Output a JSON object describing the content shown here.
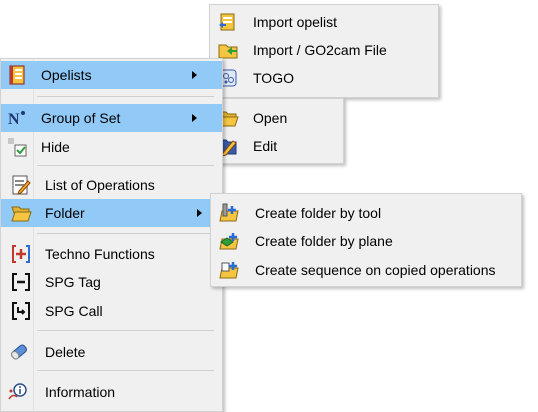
{
  "main_menu": {
    "items": [
      {
        "label": "Opelists"
      },
      {
        "label": "Group of Set"
      },
      {
        "label": "Hide"
      },
      {
        "label": "List of Operations"
      },
      {
        "label": "Folder"
      },
      {
        "label": "Techno Functions"
      },
      {
        "label": "SPG Tag"
      },
      {
        "label": "SPG Call"
      },
      {
        "label": "Delete"
      },
      {
        "label": "Information"
      }
    ]
  },
  "opelists_submenu": {
    "items": [
      {
        "label": "Import opelist"
      },
      {
        "label": "Import / GO2cam File"
      },
      {
        "label": "TOGO"
      }
    ]
  },
  "group_submenu": {
    "items": [
      {
        "label": "Open"
      },
      {
        "label": "Edit"
      }
    ]
  },
  "folder_submenu": {
    "items": [
      {
        "label": "Create folder by tool"
      },
      {
        "label": "Create folder by plane"
      },
      {
        "label": "Create sequence on copied operations"
      }
    ]
  },
  "colors": {
    "highlight": "#91c9f7",
    "menu_bg": "#f0f0f0",
    "folder_yellow": "#f5c542",
    "accent_blue": "#2b6cd4"
  },
  "icons": {
    "opelists": "opelist-book-icon",
    "group": "group-of-set-icon",
    "hide": "hide-icon",
    "list": "list-of-operations-icon",
    "folder": "folder-icon",
    "techno": "techno-functions-icon",
    "spg_tag": "spg-tag-icon",
    "spg_call": "spg-call-icon",
    "delete": "eraser-icon",
    "info": "information-icon"
  }
}
